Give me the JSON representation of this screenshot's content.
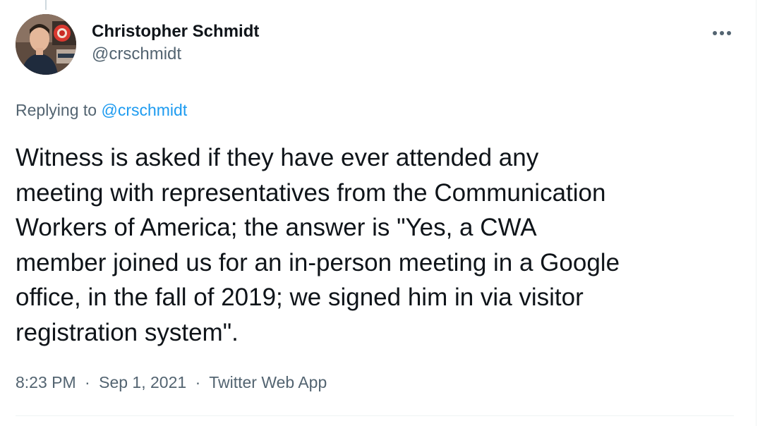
{
  "author": {
    "display_name": "Christopher Schmidt",
    "handle": "@crschmidt"
  },
  "reply": {
    "prefix": "Replying to",
    "to": "@crschmidt"
  },
  "tweet": {
    "lines": [
      "Witness is asked if they have ever attended any",
      "meeting with representatives from the Communication",
      "Workers of America; the answer is \"Yes, a CWA",
      "member joined us for an in-person meeting in a Google",
      "office, in the fall of 2019; we signed him in via visitor",
      "registration system\"."
    ]
  },
  "meta": {
    "time": "8:23 PM",
    "date": "Sep 1, 2021",
    "source": "Twitter Web App",
    "separator": "·"
  },
  "icons": {
    "more": "more-horizontal-icon"
  },
  "colors": {
    "link": "#1d9bf0",
    "secondary_text": "#536471",
    "primary_text": "#0f1419",
    "divider": "#eff3f4"
  }
}
